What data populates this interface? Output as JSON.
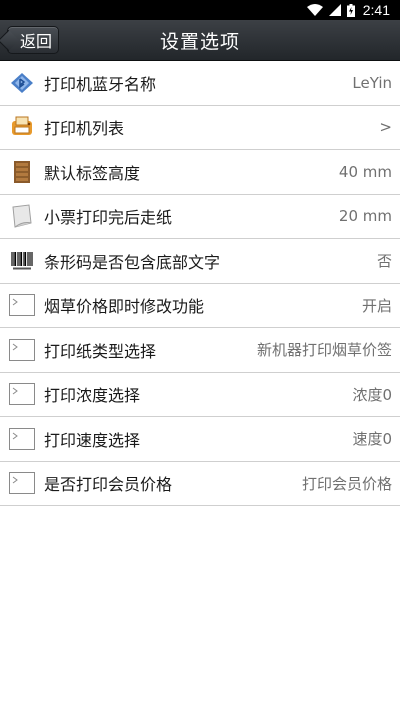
{
  "status_bar": {
    "time": "2:41"
  },
  "header": {
    "back_label": "返回",
    "title": "设置选项"
  },
  "settings": [
    {
      "label": "打印机蓝牙名称",
      "value": "LeYin",
      "icon": "bluetooth-icon"
    },
    {
      "label": "打印机列表",
      "value": ">",
      "icon": "printer-list-icon"
    },
    {
      "label": "默认标签高度",
      "value": "40 mm",
      "icon": "label-icon"
    },
    {
      "label": "小票打印完后走纸",
      "value": "20 mm",
      "icon": "paper-icon"
    },
    {
      "label": "条形码是否包含底部文字",
      "value": "否",
      "icon": "barcode-icon"
    },
    {
      "label": "烟草价格即时修改功能",
      "value": "开启",
      "icon": "terminal-icon"
    },
    {
      "label": "打印纸类型选择",
      "value": "新机器打印烟草价签",
      "icon": "terminal-icon"
    },
    {
      "label": "打印浓度选择",
      "value": "浓度0",
      "icon": "terminal-icon"
    },
    {
      "label": "打印速度选择",
      "value": "速度0",
      "icon": "terminal-icon"
    },
    {
      "label": "是否打印会员价格",
      "value": "打印会员价格",
      "icon": "terminal-icon"
    }
  ]
}
